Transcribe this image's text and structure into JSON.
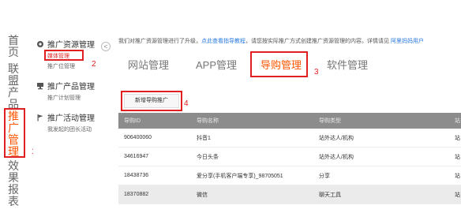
{
  "left_nav": {
    "items": [
      {
        "label": "首页"
      },
      {
        "label": "联盟产品"
      },
      {
        "label": "推广管理"
      },
      {
        "label": "效果报表"
      }
    ]
  },
  "side_menu": {
    "groups": [
      {
        "title": "推广资源管理",
        "icon": "gear-icon",
        "items": [
          "媒体管理",
          "推广位管理"
        ]
      },
      {
        "title": "推广产品管理",
        "icon": "computer-icon",
        "items": [
          "推广计划管理"
        ]
      },
      {
        "title": "推广活动管理",
        "icon": "flag-icon",
        "items": [
          "我发起的团长活动"
        ]
      }
    ],
    "collapse_glyph": "<"
  },
  "notice": {
    "text_before": "我们对推广资源管理进行了升级，",
    "link1": "点此查看指导教程",
    "text_middle": "，请您按实际推广方式创建推广资源管理的内容。详情请见 ",
    "link2": "阿里妈妈用户"
  },
  "tabs": [
    "网站管理",
    "APP管理",
    "导购管理",
    "软件管理"
  ],
  "active_tab": "导购管理",
  "new_button_label": "新增导购推广",
  "table": {
    "columns": [
      "导购ID",
      "导购名称",
      "导购类型",
      "站"
    ],
    "rows": [
      [
        "906400060",
        "抖音1",
        "站外达人/机构",
        "站"
      ],
      [
        "34616947",
        "今日头条",
        "站外达人/机构",
        "站"
      ],
      [
        "18438736",
        "爱分享(手机客户端专享)_98705051",
        "分享",
        "站"
      ],
      [
        "18370882",
        "微信",
        "聊天工具",
        "站"
      ]
    ]
  },
  "annotations": [
    "1",
    "2",
    "3",
    "4"
  ],
  "colors": {
    "accent": "#ff5500",
    "annotation_red": "#e02020",
    "link": "#2a7ae2",
    "header_gray": "#8c8c8c"
  }
}
